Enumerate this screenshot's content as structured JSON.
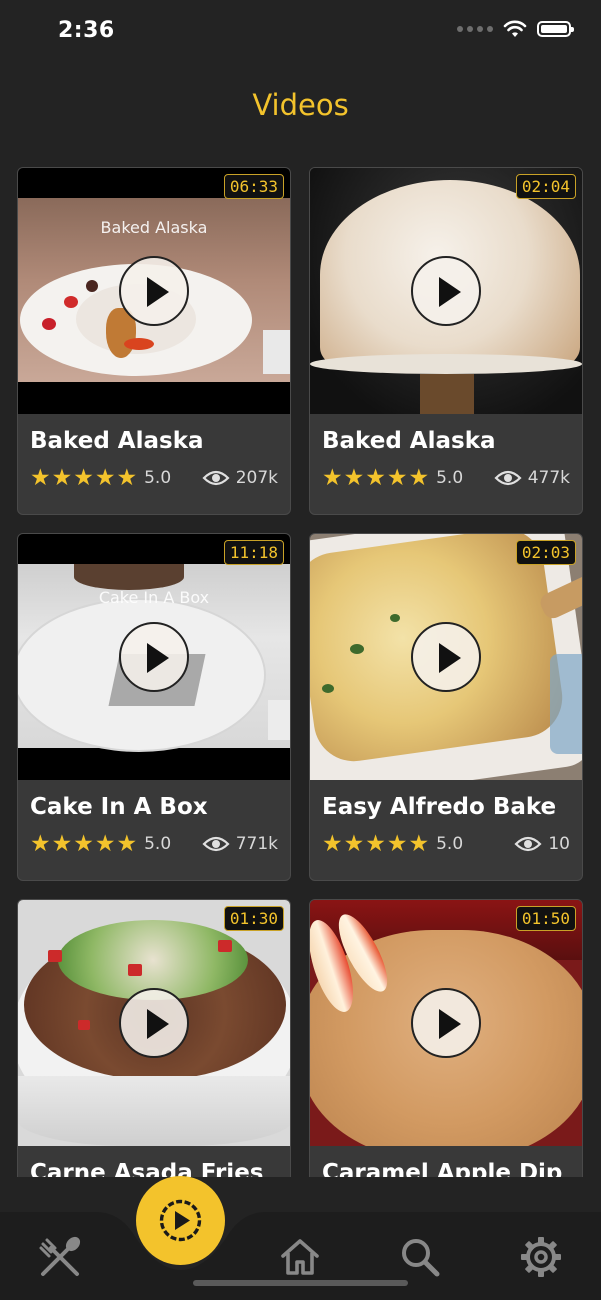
{
  "status_bar": {
    "time": "2:36"
  },
  "header": {
    "title": "Videos"
  },
  "colors": {
    "accent": "#f3c32c",
    "background": "#232323",
    "card": "#393939"
  },
  "videos": [
    {
      "title": "Baked Alaska",
      "duration": "06:33",
      "stars": "★★★★★",
      "rating": "5.0",
      "views": "207k",
      "overlay": "Baked Alaska"
    },
    {
      "title": "Baked Alaska",
      "duration": "02:04",
      "stars": "★★★★★",
      "rating": "5.0",
      "views": "477k"
    },
    {
      "title": "Cake In A Box",
      "duration": "11:18",
      "stars": "★★★★★",
      "rating": "5.0",
      "views": "771k",
      "overlay": "Cake In A Box"
    },
    {
      "title": "Easy Alfredo Bake",
      "duration": "02:03",
      "stars": "★★★★★",
      "rating": "5.0",
      "views": "10"
    },
    {
      "title": "Carne Asada Fries",
      "duration": "01:30"
    },
    {
      "title": "Caramel Apple Dip",
      "duration": "01:50"
    }
  ],
  "tabbar": {
    "items": [
      {
        "icon": "fork-spoon-icon"
      },
      {
        "icon": "play-video-icon",
        "active": true
      },
      {
        "icon": "home-icon"
      },
      {
        "icon": "search-icon"
      },
      {
        "icon": "gear-icon"
      }
    ]
  }
}
